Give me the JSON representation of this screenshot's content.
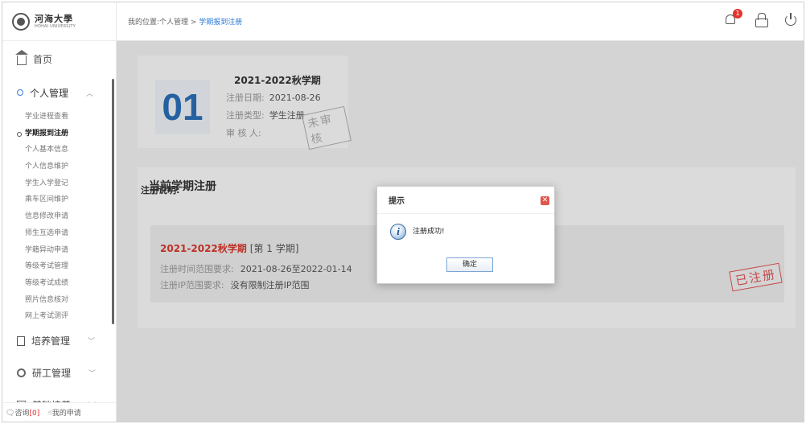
{
  "logo": {
    "name": "河海大學",
    "subtitle": "HOHAI UNIVERSITY"
  },
  "breadcrumb": {
    "prefix": "我的位置:个人管理 > ",
    "current": "学期报到注册"
  },
  "header": {
    "notification_count": "1"
  },
  "sidebar": {
    "home": "首页",
    "personal": {
      "label": "个人管理",
      "items": [
        "学业进程查看",
        "学期报到注册",
        "个人基本信息",
        "个人信息维护",
        "学生入学登记",
        "乘车区间维护",
        "信息修改申请",
        "师生互选申请",
        "学籍异动申请",
        "等级考试管理",
        "等级考试成绩",
        "照片信息核对",
        "网上考试测评"
      ],
      "active_index": 1
    },
    "training": "培养管理",
    "research": "研工管理",
    "basic": "基础培养"
  },
  "bottom": {
    "consult": "咨询",
    "consult_count": "[0]",
    "my_apply": "我的申请"
  },
  "term_card": {
    "number": "01",
    "title": "2021-2022秋学期",
    "date_label": "注册日期:",
    "date_value": "2021-08-26",
    "type_label": "注册类型:",
    "type_value": "学生注册",
    "reviewer_label": "审 核 人:",
    "stamp": "未审核"
  },
  "registration": {
    "heading": "当前学期注册",
    "term": "2021-2022秋学期",
    "term_index": "[第 1 学期]",
    "time_label": "注册时间范围要求:",
    "time_value": "2021-08-26至2022-01-14",
    "ip_label": "注册IP范围要求:",
    "ip_value": "没有限制注册IP范围",
    "stamp": "已注册",
    "note_label": "注册说明:"
  },
  "dialog": {
    "title": "提示",
    "message": "注册成功!",
    "ok_label": "确定"
  },
  "colors": {
    "accent": "#2a78d8",
    "term_red": "#d8372b",
    "stamp_red": "#e05555",
    "badge": "#e5322d"
  }
}
